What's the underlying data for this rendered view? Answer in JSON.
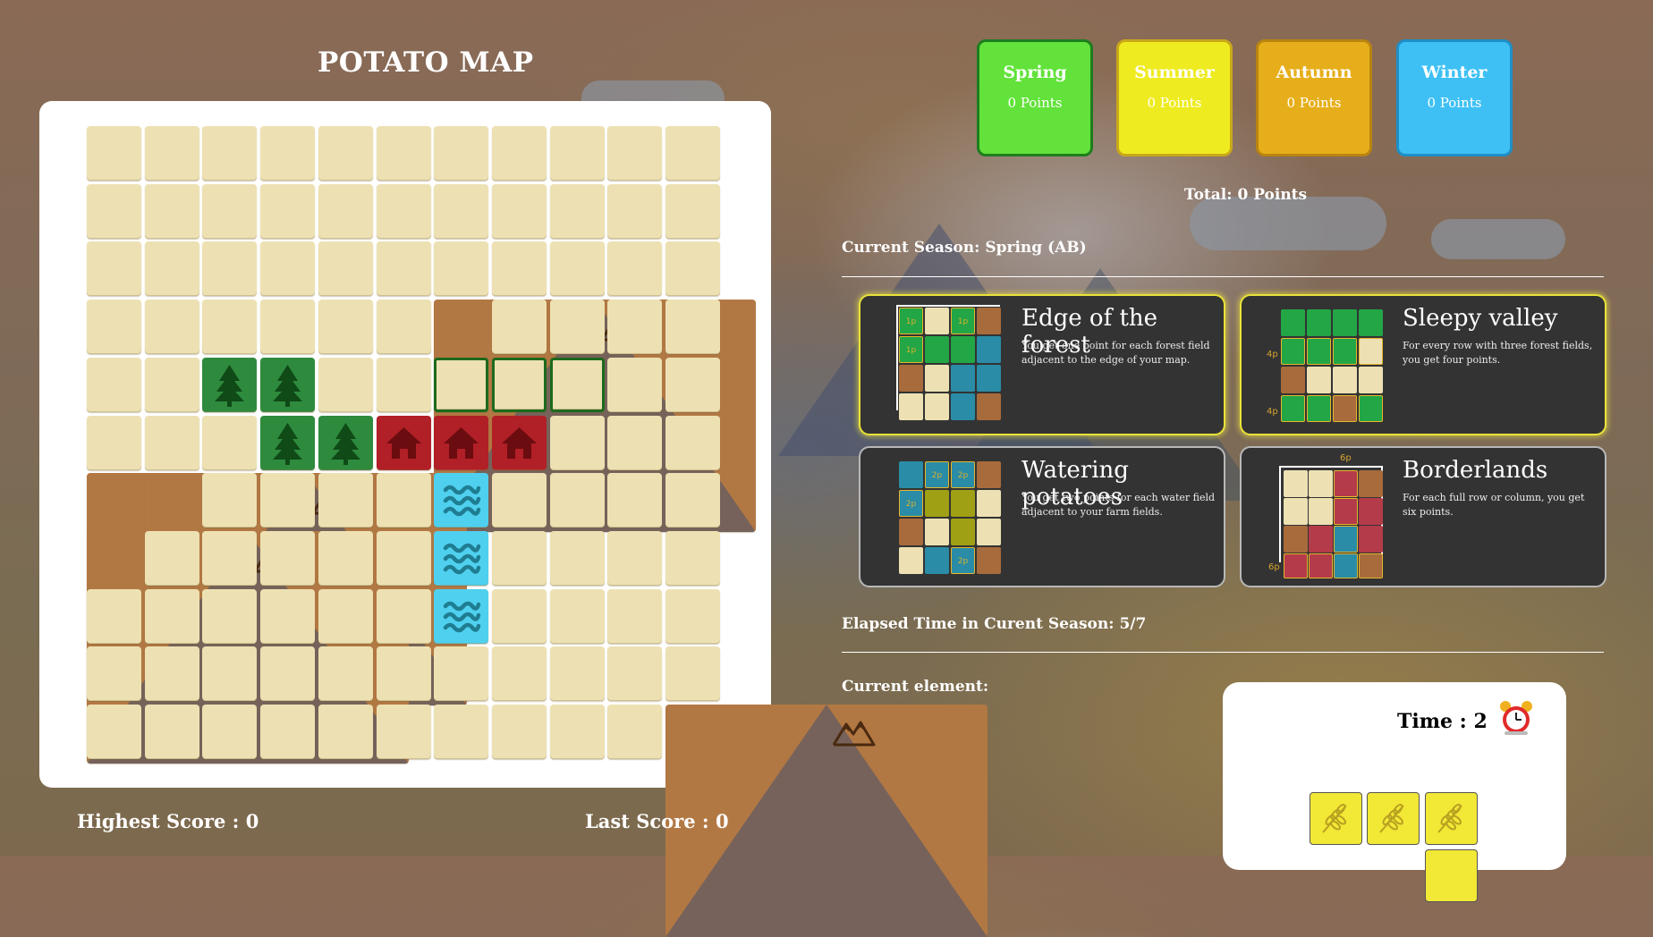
{
  "title": "POTATO MAP",
  "grid": {
    "rows": [
      [
        "empty",
        "empty",
        "empty",
        "empty",
        "empty",
        "empty",
        "empty",
        "empty",
        "empty",
        "empty",
        "empty"
      ],
      [
        "empty",
        "empty",
        "empty",
        "empty",
        "empty",
        "empty",
        "empty",
        "empty",
        "empty",
        "empty",
        "empty"
      ],
      [
        "empty",
        "empty",
        "empty",
        "empty",
        "empty",
        "empty",
        "empty",
        "empty",
        "empty",
        "empty",
        "empty"
      ],
      [
        "empty",
        "empty",
        "empty",
        "empty",
        "empty",
        "empty",
        "mountain",
        "empty",
        "empty",
        "empty",
        "empty"
      ],
      [
        "empty",
        "empty",
        "forest",
        "forest",
        "empty",
        "empty",
        "preview",
        "preview",
        "preview",
        "empty",
        "empty"
      ],
      [
        "empty",
        "empty",
        "empty",
        "forest",
        "forest",
        "village",
        "village",
        "village",
        "empty",
        "empty",
        "empty"
      ],
      [
        "mountain",
        "mountain",
        "empty",
        "empty",
        "empty",
        "empty",
        "water",
        "empty",
        "empty",
        "empty",
        "empty"
      ],
      [
        "mountain",
        "empty",
        "empty",
        "empty",
        "empty",
        "empty",
        "water",
        "empty",
        "empty",
        "empty",
        "empty"
      ],
      [
        "empty",
        "empty",
        "empty",
        "empty",
        "empty",
        "empty",
        "water",
        "empty",
        "empty",
        "empty",
        "empty"
      ],
      [
        "empty",
        "empty",
        "empty",
        "empty",
        "empty",
        "empty",
        "empty",
        "empty",
        "empty",
        "empty",
        "empty"
      ],
      [
        "empty",
        "empty",
        "empty",
        "empty",
        "empty",
        "empty",
        "empty",
        "empty",
        "empty",
        "empty",
        "mountain"
      ]
    ]
  },
  "scores": {
    "highest": "Highest Score : 0",
    "last": "Last Score : 0"
  },
  "seasons": [
    {
      "name": "Spring",
      "points": "0 Points",
      "color": "#62e23a",
      "border": "#1e7d1e"
    },
    {
      "name": "Summer",
      "points": "0 Points",
      "color": "#eeeb20",
      "border": "#c8a81a"
    },
    {
      "name": "Autumn",
      "points": "0 Points",
      "color": "#e6ae1a",
      "border": "#b98410"
    },
    {
      "name": "Winter",
      "points": "0 Points",
      "color": "#3ec0f4",
      "border": "#1e8fc6"
    }
  ],
  "total": "Total: 0 Points",
  "current_season": "Current Season: Spring (AB)",
  "missions": [
    {
      "title": "Edge of the forest",
      "description": "You get one point for each forest field adjacent to the edge of your map.",
      "active": true
    },
    {
      "title": "Sleepy valley",
      "description": "For every row with three forest fields, you get four points.",
      "active": true
    },
    {
      "title": "Watering potatoes",
      "description": "You get two points for each water field adjacent to your farm fields.",
      "active": false
    },
    {
      "title": "Borderlands",
      "description": "For each full row or column, you get six points.",
      "active": false
    }
  ],
  "mission_labels": {
    "one_point": "1p",
    "two_points": "2p",
    "four_points": "4p",
    "six_points": "6p"
  },
  "elapsed": "Elapsed Time in Curent Season: 5/7",
  "current_element": {
    "label": "Current element:",
    "time": "Time : 2",
    "type": "farm",
    "icon": "alarm-clock-icon",
    "color": "#f2e836"
  },
  "icons": {
    "forest": "pine-tree-icon",
    "village": "house-icon",
    "water": "waves-icon",
    "mountain": "mountain-icon",
    "farm": "wheat-icon"
  }
}
